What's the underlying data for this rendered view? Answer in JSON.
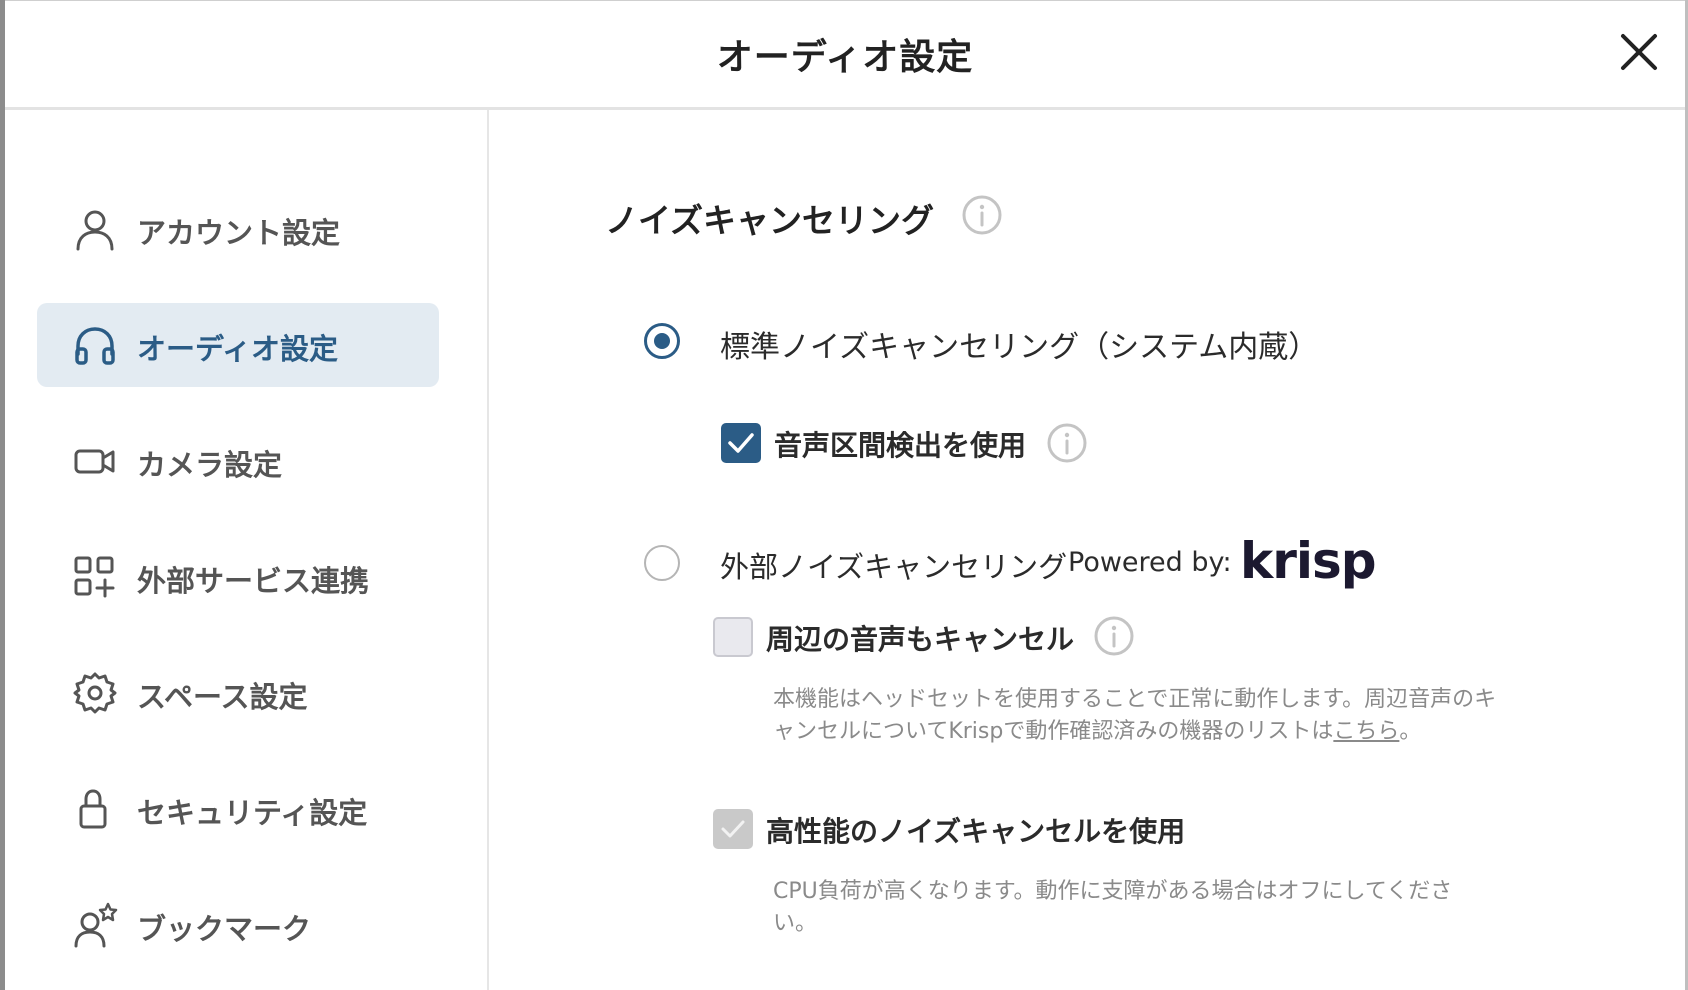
{
  "header": {
    "title": "オーディオ設定"
  },
  "sidebar": {
    "items": [
      {
        "label": "アカウント設定",
        "icon": "user-icon",
        "active": false
      },
      {
        "label": "オーディオ設定",
        "icon": "headphones-icon",
        "active": true
      },
      {
        "label": "カメラ設定",
        "icon": "camera-icon",
        "active": false
      },
      {
        "label": "外部サービス連携",
        "icon": "apps-add-icon",
        "active": false
      },
      {
        "label": "スペース設定",
        "icon": "gear-icon",
        "active": false
      },
      {
        "label": "セキュリティ設定",
        "icon": "lock-icon",
        "active": false
      },
      {
        "label": "ブックマーク",
        "icon": "user-star-icon",
        "active": false
      }
    ]
  },
  "main": {
    "section_title": "ノイズキャンセリング",
    "standard": {
      "label": "標準ノイズキャンセリング（システム内蔵）",
      "selected": true,
      "vad_label": "音声区間検出を使用",
      "vad_checked": true
    },
    "external": {
      "label": "外部ノイズキャンセリング",
      "powered_by": "Powered by:",
      "brand": "krisp",
      "selected": false,
      "cancel_surround_label": "周辺の音声もキャンセル",
      "cancel_surround_checked": false,
      "cancel_surround_desc": "本機能はヘッドセットを使用することで正常に動作します。周辺音声のキャンセルについてKrispで動作確認済みの機器のリストは",
      "cancel_surround_link": "こちら",
      "cancel_surround_desc_end": "。",
      "high_perf_label": "高性能のノイズキャンセルを使用",
      "high_perf_checked": true,
      "high_perf_desc": "CPU負荷が高くなります。動作に支障がある場合はオフにしてください。"
    }
  },
  "colors": {
    "accent": "#2b5c86",
    "active_bg": "#e3ebf2",
    "muted_text": "#8a8a8a"
  }
}
